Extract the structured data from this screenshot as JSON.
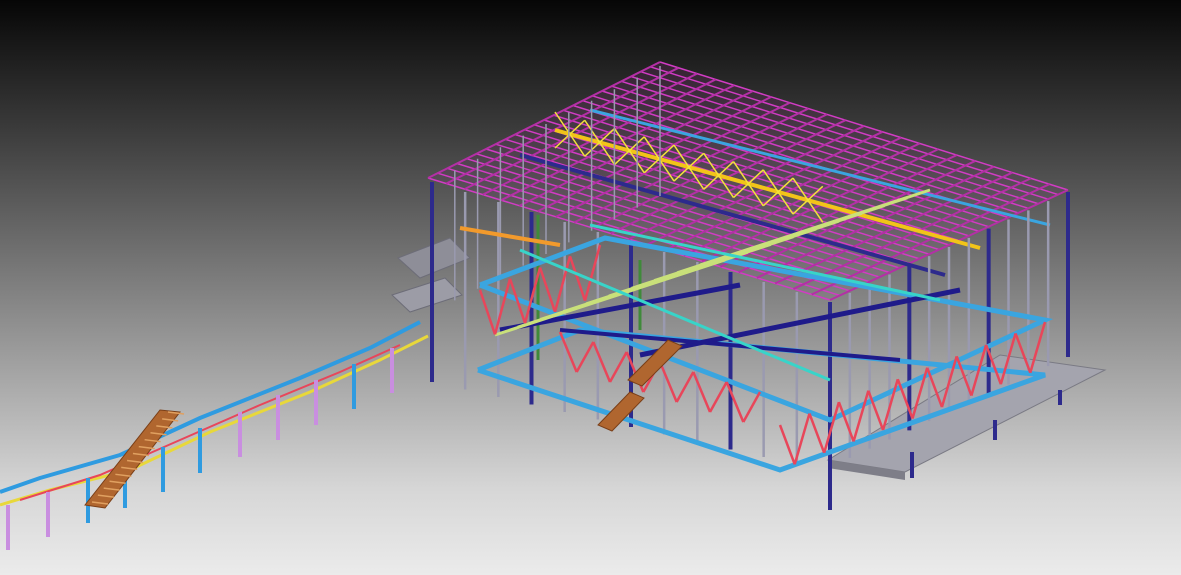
{
  "viewer": {
    "background_top": "#060606",
    "background_bottom": "#ebebeb"
  },
  "model": {
    "description_type": "3D structural steel frame model (BIM view)",
    "member_colors": {
      "roof_purlins": "#d13cc4",
      "roof_rafters": "#b42fa6",
      "roof_ridge_beam": "#f2c418",
      "roof_bracing": "#f2e23a",
      "columns_grey": "#9a9ab0",
      "columns_navy": "#2d2a8c",
      "floor_beams_blue": "#3aa5e0",
      "floor_beams_navy": "#1f1b8a",
      "truss_bracing_red": "#e8465a",
      "joists_yellowgreen": "#c9e07a",
      "cyan_members": "#38d4c9",
      "green_columns": "#3f8a3a",
      "stair_brown": "#b0662f",
      "walkway_blue": "#2f9be0",
      "walkway_yellow": "#e8d83a",
      "walkway_violet": "#c98ee0",
      "decking_grey": "#9c9ca6"
    }
  }
}
